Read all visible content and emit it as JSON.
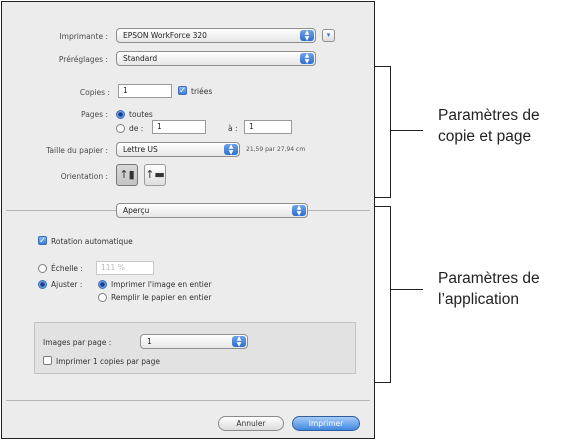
{
  "dialog": {
    "printer": {
      "label": "Imprimante :",
      "value": "EPSON WorkForce 320"
    },
    "presets": {
      "label": "Préréglages :",
      "value": "Standard"
    },
    "copies": {
      "label": "Copies :",
      "value": "1",
      "collated_label": "triées",
      "collated": true
    },
    "pages": {
      "label": "Pages :",
      "all_label": "toutes",
      "from_label": "de :",
      "from_value": "1",
      "to_label": "à :",
      "to_value": "1",
      "selected": "all"
    },
    "paper_size": {
      "label": "Taille du papier :",
      "value": "Lettre US",
      "dimensions": "21,59 par 27,94 cm"
    },
    "orientation": {
      "label": "Orientation :",
      "portrait_glyph": "↑▮",
      "landscape_glyph": "↑▬"
    },
    "section_menu": {
      "value": "Aperçu"
    },
    "auto_rotate": {
      "label": "Rotation automatique",
      "checked": true
    },
    "scale": {
      "label": "Échelle :",
      "value": "111 %"
    },
    "fit": {
      "label": "Ajuster :",
      "option1": "Imprimer l'image en entier",
      "option2": "Remplir le papier en entier"
    },
    "images_per_page": {
      "label": "Images par page :",
      "value": "1"
    },
    "print_copies_per_page": {
      "label": "Imprimer 1 copies par page",
      "checked": false
    },
    "buttons": {
      "cancel": "Annuler",
      "print": "Imprimer"
    },
    "accent_color": "#3f86e0"
  },
  "annotations": {
    "top": {
      "line1": "Paramètres de",
      "line2": "copie et page"
    },
    "bottom": {
      "line1": "Paramètres de",
      "line2": "l’application"
    }
  }
}
